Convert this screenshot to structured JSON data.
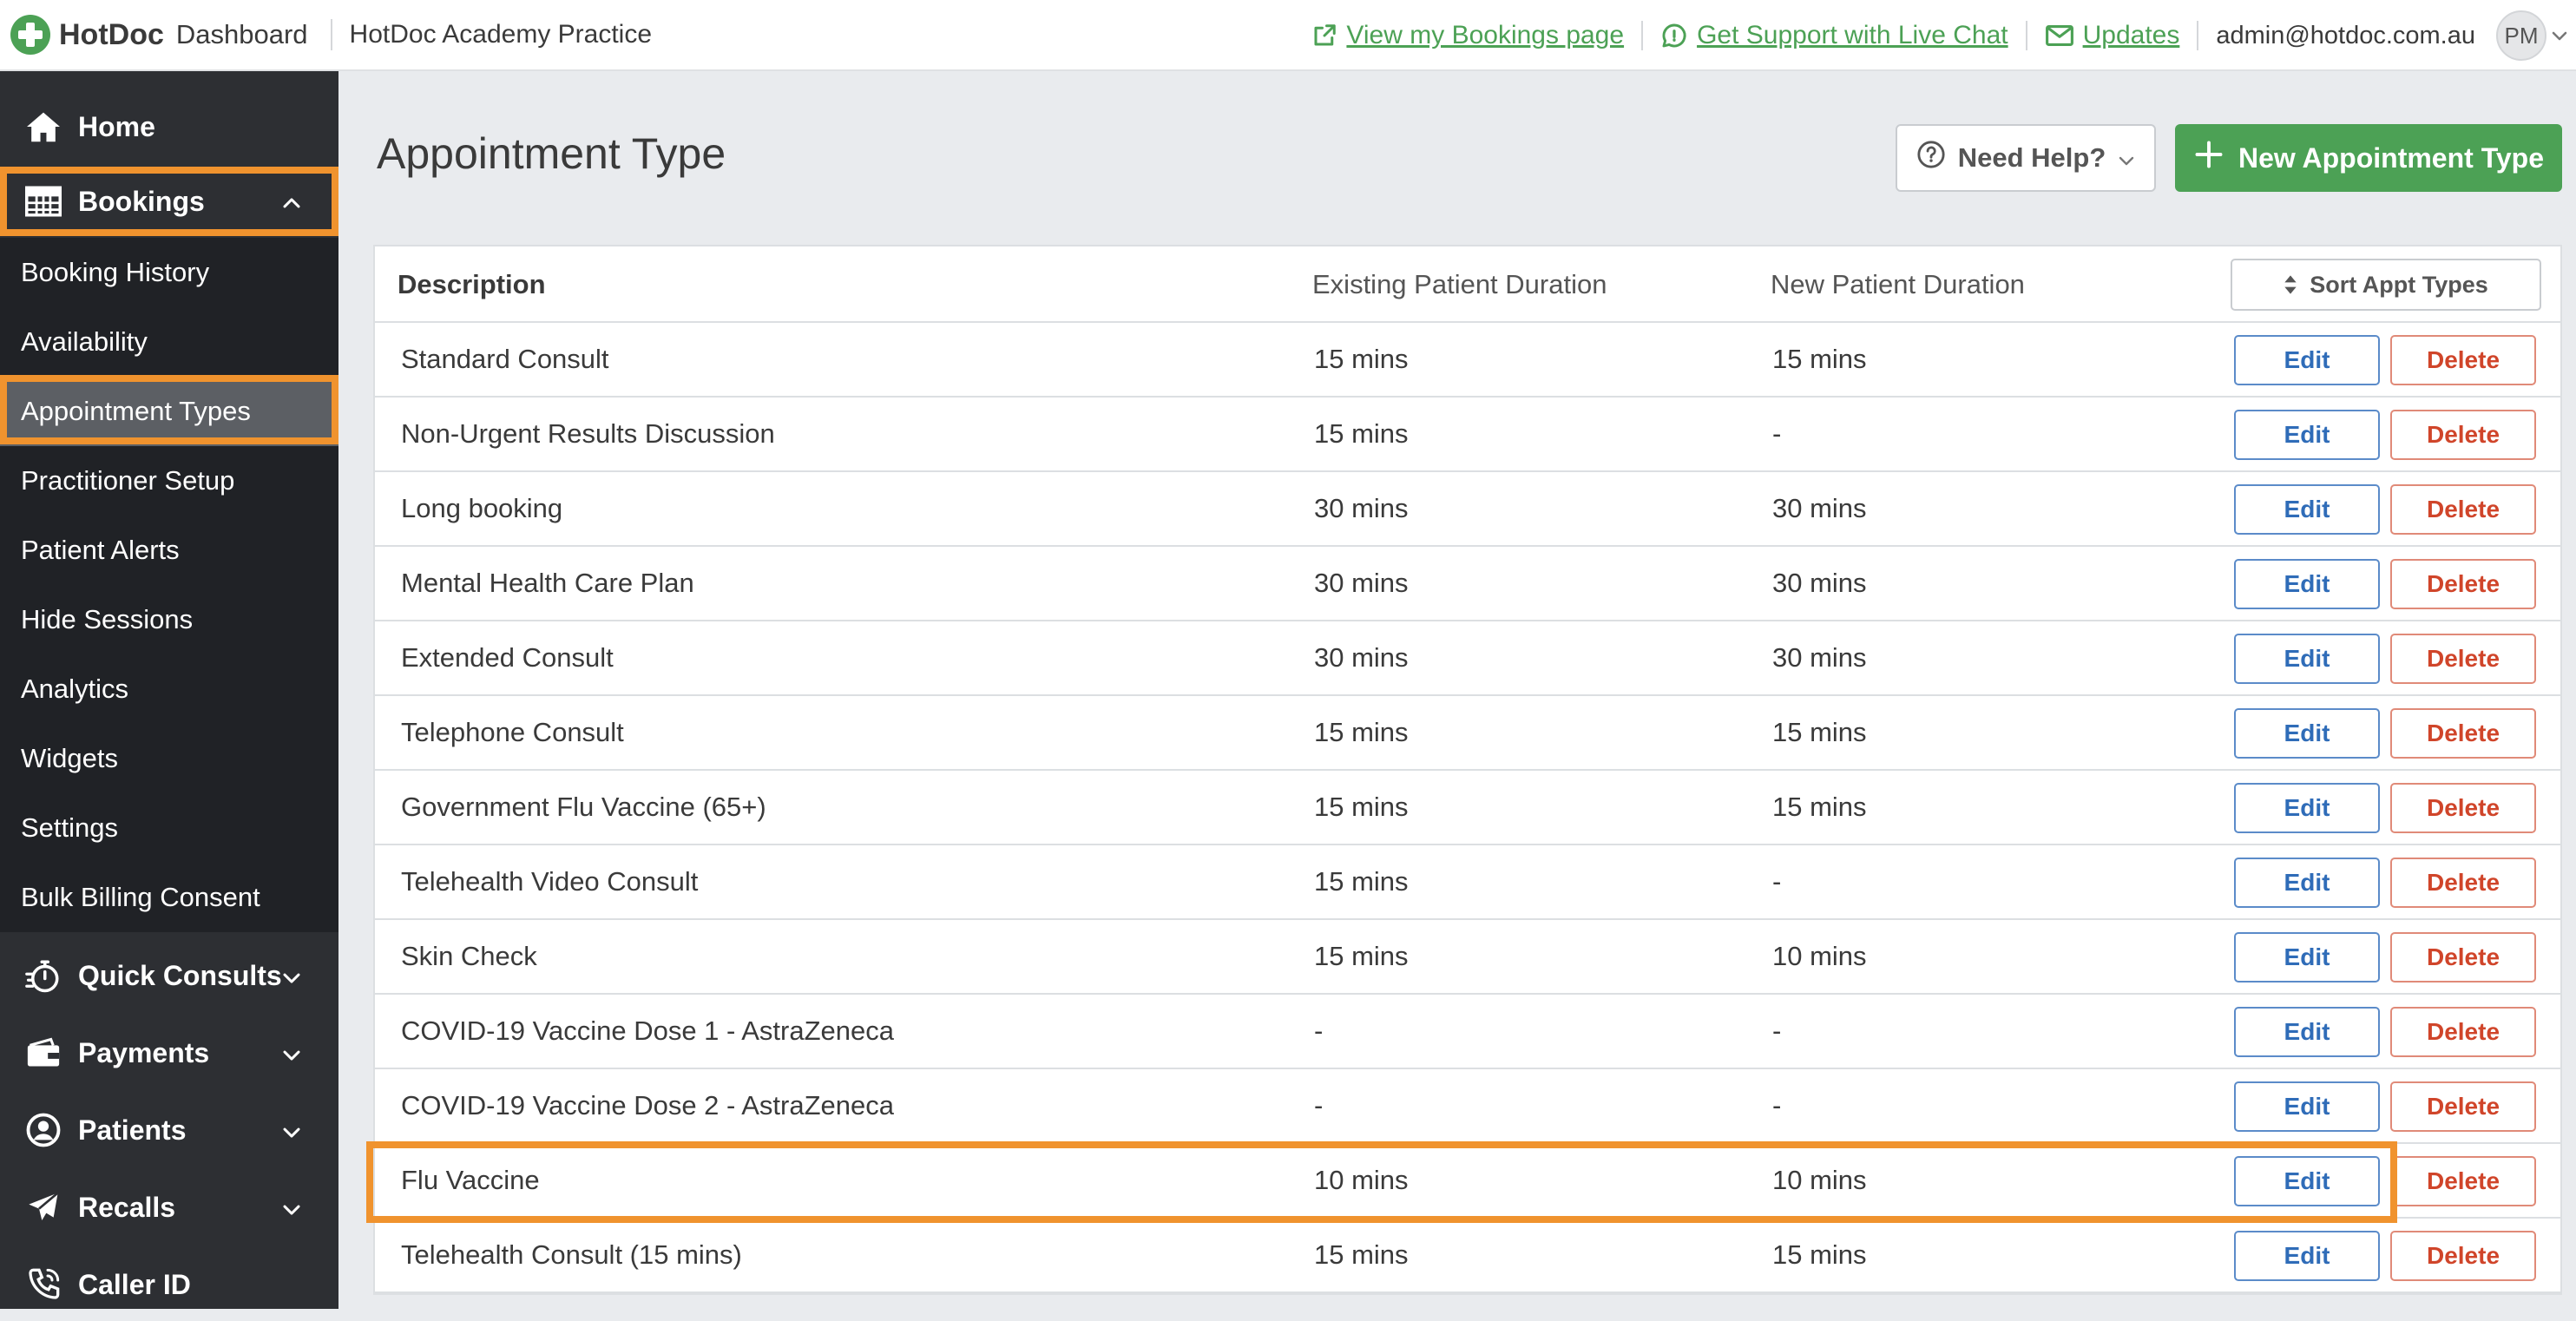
{
  "topbar": {
    "brand": "HotDoc",
    "dashboard_label": "Dashboard",
    "practice_name": "HotDoc Academy Practice",
    "links": [
      {
        "label": "View my Bookings page",
        "icon": "external-link-icon"
      },
      {
        "label": "Get Support with Live Chat",
        "icon": "chat-bubble-icon"
      },
      {
        "label": "Updates",
        "icon": "envelope-icon"
      }
    ],
    "user_email": "admin@hotdoc.com.au",
    "avatar_initials": "PM"
  },
  "sidebar": {
    "home": "Home",
    "bookings": "Bookings",
    "booking_subitems": [
      "Booking History",
      "Availability",
      "Appointment Types",
      "Practitioner Setup",
      "Patient Alerts",
      "Hide Sessions",
      "Analytics",
      "Widgets",
      "Settings",
      "Bulk Billing Consent"
    ],
    "active_subitem": "Appointment Types",
    "quick_consults": "Quick Consults",
    "payments": "Payments",
    "patients": "Patients",
    "recalls": "Recalls",
    "caller_id": "Caller ID"
  },
  "main": {
    "title": "Appointment Type",
    "help_button": "Need Help?",
    "new_button": "New Appointment Type"
  },
  "table": {
    "headers": {
      "description": "Description",
      "existing": "Existing Patient Duration",
      "new": "New Patient Duration",
      "sort_button": "Sort Appt Types"
    },
    "edit_label": "Edit",
    "delete_label": "Delete",
    "highlighted_row": "Flu Vaccine",
    "rows": [
      {
        "description": "Standard Consult",
        "existing": "15 mins",
        "new": "15 mins"
      },
      {
        "description": "Non-Urgent Results Discussion",
        "existing": "15 mins",
        "new": "-"
      },
      {
        "description": "Long booking",
        "existing": "30 mins",
        "new": "30 mins"
      },
      {
        "description": "Mental Health Care Plan",
        "existing": "30 mins",
        "new": "30 mins"
      },
      {
        "description": "Extended Consult",
        "existing": "30 mins",
        "new": "30 mins"
      },
      {
        "description": "Telephone Consult",
        "existing": "15 mins",
        "new": "15 mins"
      },
      {
        "description": "Government Flu Vaccine (65+)",
        "existing": "15 mins",
        "new": "15 mins"
      },
      {
        "description": "Telehealth Video Consult",
        "existing": "15 mins",
        "new": "-"
      },
      {
        "description": "Skin Check",
        "existing": "15 mins",
        "new": "10 mins"
      },
      {
        "description": "COVID-19 Vaccine Dose 1 - AstraZeneca",
        "existing": "-",
        "new": "-"
      },
      {
        "description": "COVID-19 Vaccine Dose 2 - AstraZeneca",
        "existing": "-",
        "new": "-"
      },
      {
        "description": "Flu Vaccine",
        "existing": "10 mins",
        "new": "10 mins"
      },
      {
        "description": "Telehealth Consult (15 mins)",
        "existing": "15 mins",
        "new": "15 mins"
      }
    ]
  },
  "colors": {
    "brand_green": "#4ca155",
    "sidebar_bg": "#2d2f33",
    "highlight_orange": "#f0932e",
    "edit_blue": "#2f6cb8",
    "delete_red": "#d0452a"
  }
}
